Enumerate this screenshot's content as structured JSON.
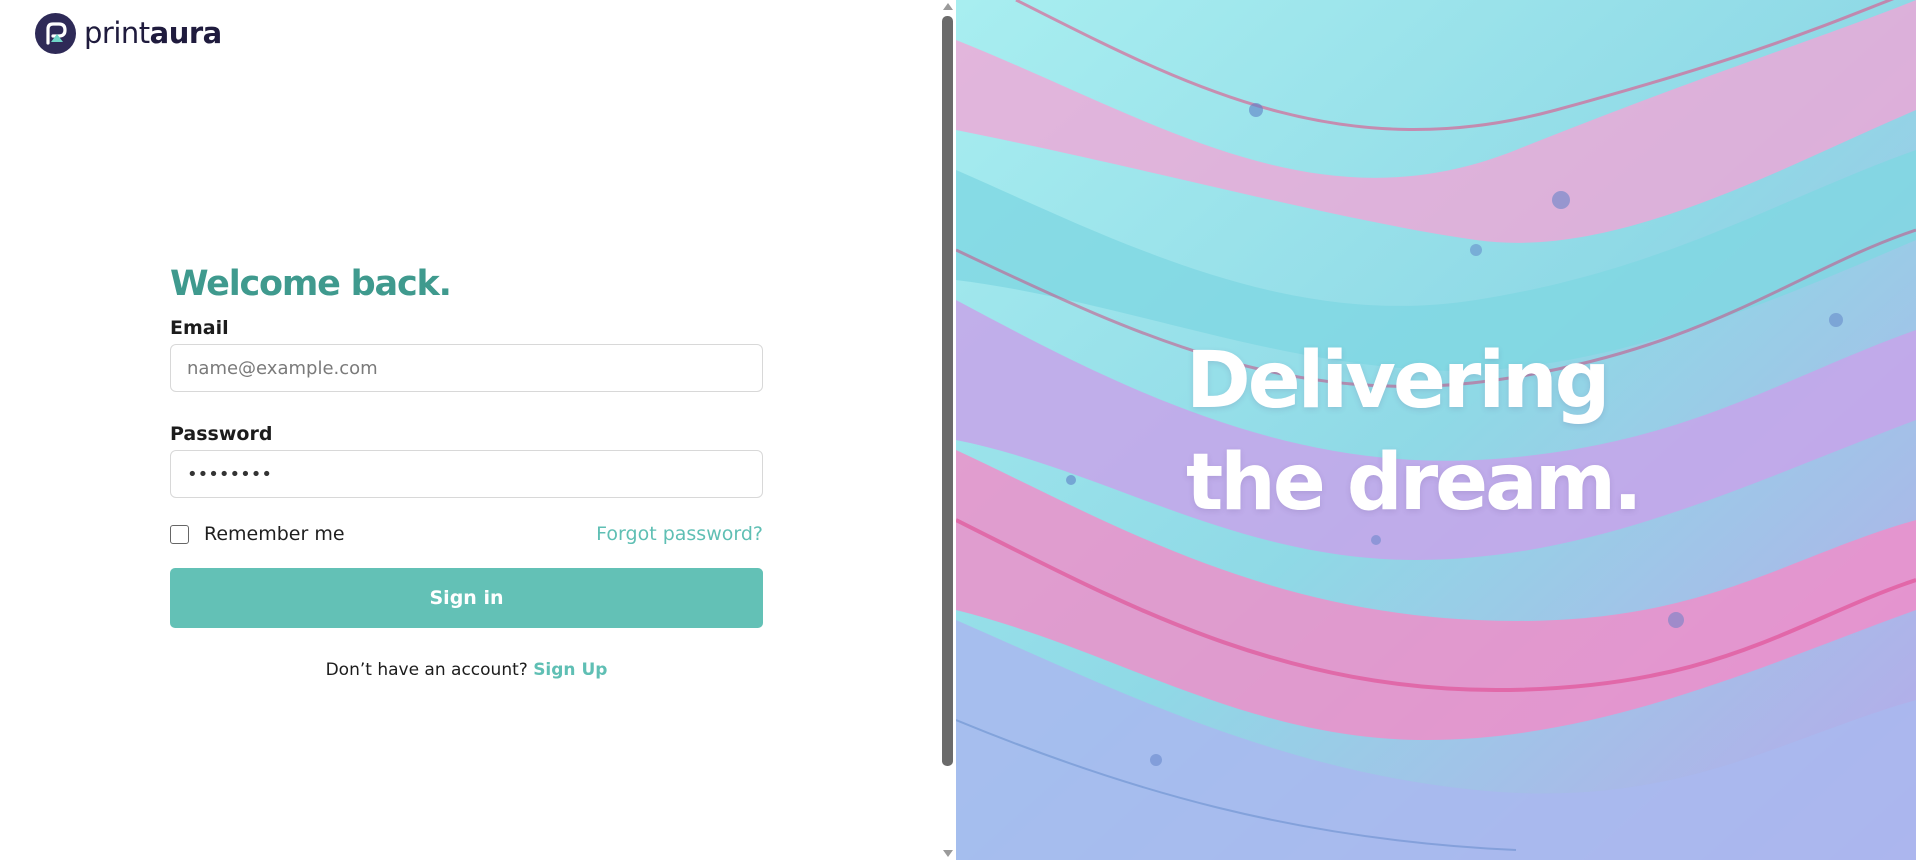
{
  "brand": {
    "logo_text_light": "print",
    "logo_text_bold": "aura"
  },
  "login": {
    "heading": "Welcome back.",
    "email_label": "Email",
    "email_placeholder": "name@example.com",
    "password_label": "Password",
    "password_value": "••••••••",
    "remember_label": "Remember me",
    "forgot_label": "Forgot password?",
    "signin_label": "Sign in",
    "no_account_text": "Don’t have an account?",
    "signup_label": "Sign Up"
  },
  "hero": {
    "line1": "Delivering",
    "line2": "the dream."
  },
  "colors": {
    "accent": "#63c1b6",
    "heading": "#3f9a8e",
    "logo_mark": "#2e2a57"
  }
}
